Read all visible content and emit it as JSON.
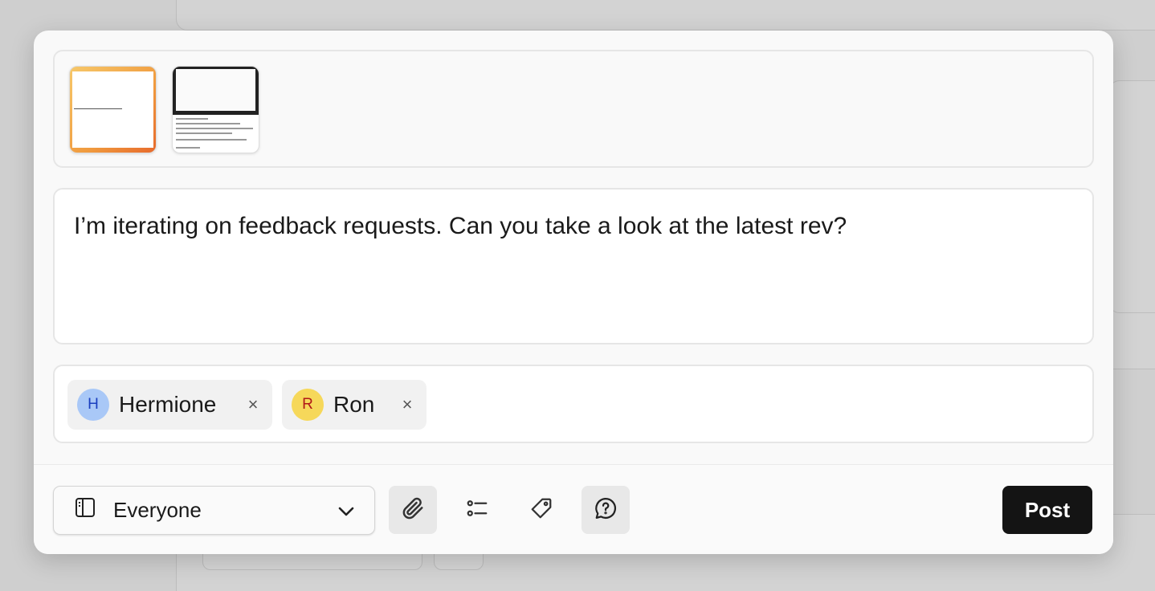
{
  "composer": {
    "attachments": [
      {
        "name": "attachment-thumbnail-1"
      },
      {
        "name": "attachment-thumbnail-2"
      }
    ],
    "message_text": "I’m iterating on feedback requests. Can you take a look at the latest rev?",
    "recipients": [
      {
        "initial": "H",
        "name": "Hermione",
        "avatar_bg": "#a9c8f7",
        "avatar_fg": "#1a3fbf",
        "remove": "×"
      },
      {
        "initial": "R",
        "name": "Ron",
        "avatar_bg": "#f6d85a",
        "avatar_fg": "#b01818",
        "remove": "×"
      }
    ]
  },
  "footer": {
    "audience_label": "Everyone",
    "audience_icon": "sidebar-panel-icon",
    "tools": [
      "paperclip-icon",
      "checklist-icon",
      "tag-icon",
      "question-bubble-icon"
    ],
    "post_label": "Post"
  }
}
